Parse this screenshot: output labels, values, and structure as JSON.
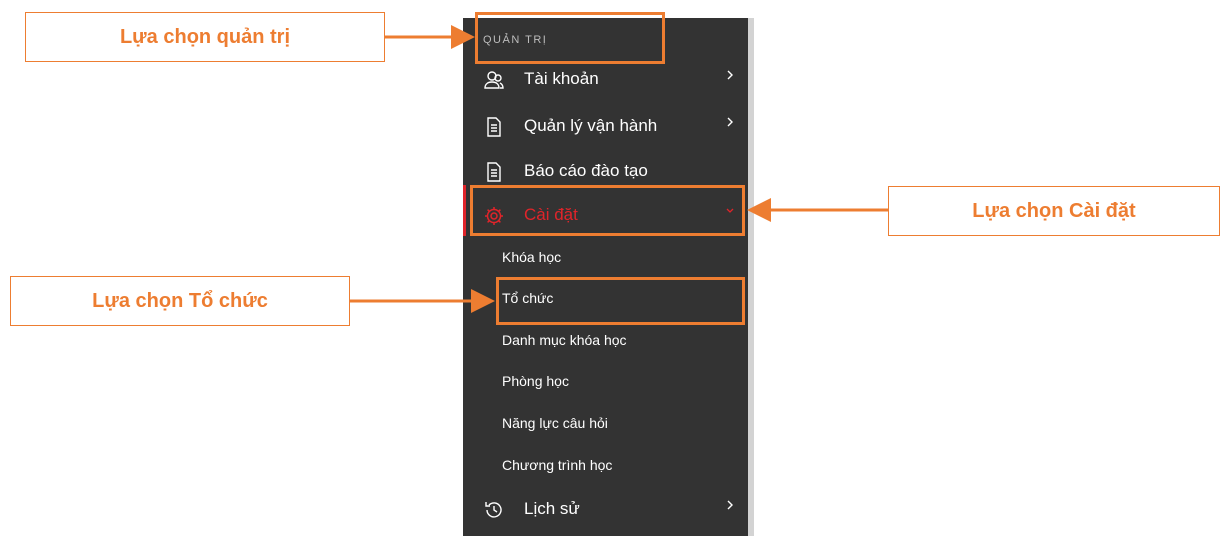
{
  "sidebar": {
    "section_header": "QUẢN TRỊ",
    "items": [
      {
        "label": "Tài khoản",
        "icon": "user-group-icon",
        "has_chevron": true
      },
      {
        "label": "Quản lý vận hành",
        "icon": "document-icon",
        "has_chevron": true
      },
      {
        "label": "Báo cáo đào tạo",
        "icon": "document-icon",
        "has_chevron": false
      },
      {
        "label": "Cài đặt",
        "icon": "gear-icon",
        "has_chevron": true,
        "active": true
      },
      {
        "label": "Lịch sử",
        "icon": "history-icon",
        "has_chevron": true
      }
    ],
    "settings_submenu": [
      "Khóa học",
      "Tổ chức",
      "Danh mục khóa học",
      "Phòng học",
      "Năng lực câu hỏi",
      "Chương trình học"
    ]
  },
  "annotations": {
    "admin": "Lựa chọn quản trị",
    "settings": "Lựa chọn Cài đặt",
    "organization": "Lựa chọn Tổ chức"
  },
  "colors": {
    "sidebar_bg": "#333333",
    "active_red": "#e0242a",
    "annotation_orange": "#ed7d31",
    "text_white": "#ffffff"
  }
}
